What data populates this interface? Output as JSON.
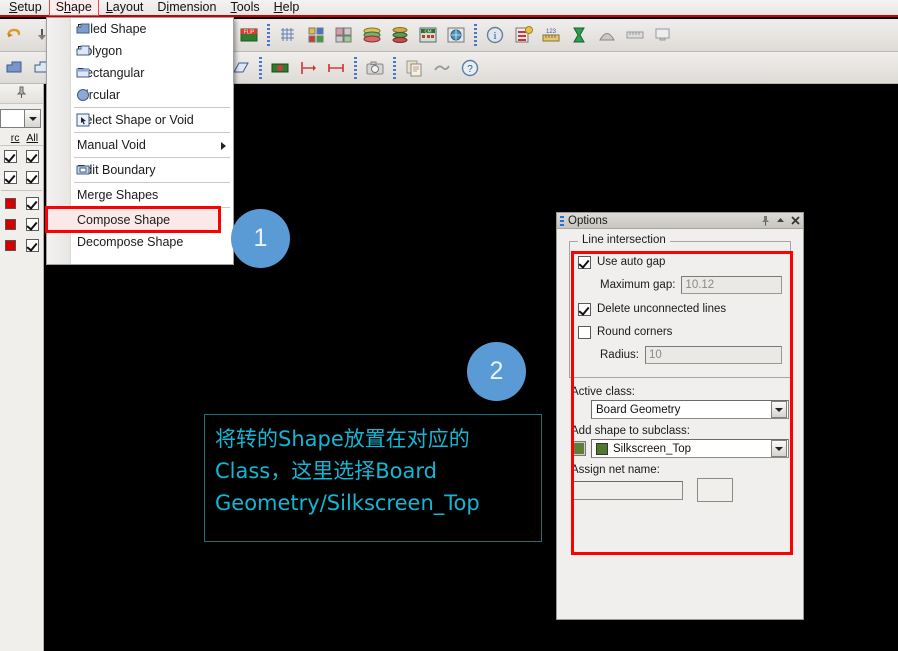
{
  "menubar": {
    "items": [
      {
        "label": "Setup",
        "mnemonic": "S",
        "active": false
      },
      {
        "label": "Shape",
        "mnemonic": "h",
        "active": true
      },
      {
        "label": "Layout",
        "mnemonic": "L",
        "active": false
      },
      {
        "label": "Dimension",
        "mnemonic": "i",
        "active": false
      },
      {
        "label": "Tools",
        "mnemonic": "T",
        "active": false
      },
      {
        "label": "Help",
        "mnemonic": "H",
        "active": false
      }
    ]
  },
  "shape_menu": {
    "highlighted_item": "Compose Shape",
    "items": [
      {
        "label": "Filled Shape",
        "icon": "filled-shape-icon",
        "separator_after": false
      },
      {
        "label": "Polygon",
        "icon": "polygon-icon",
        "separator_after": false
      },
      {
        "label": "Rectangular",
        "icon": "rectangular-icon",
        "separator_after": false
      },
      {
        "label": "Circular",
        "icon": "circular-icon",
        "separator_after": true
      },
      {
        "label": "Select Shape or Void",
        "icon": "select-shape-icon",
        "separator_after": true
      },
      {
        "label": "Manual Void",
        "icon": "",
        "separator_after": true,
        "submenu": true
      },
      {
        "label": "Edit Boundary",
        "icon": "edit-boundary-icon",
        "separator_after": true
      },
      {
        "label": "Merge Shapes",
        "icon": "",
        "separator_after": true
      },
      {
        "label": "Compose Shape",
        "icon": "",
        "separator_after": false,
        "highlighted": true
      },
      {
        "label": "Decompose Shape",
        "icon": "",
        "separator_after": false
      }
    ]
  },
  "left_panel": {
    "header_visibility": "rc",
    "header_all": "All",
    "rows": [
      {
        "swatch": "",
        "checked": true
      },
      {
        "swatch": "",
        "checked": true
      },
      {
        "swatch": "#d40000",
        "checked": true
      },
      {
        "swatch": "#d40000",
        "checked": true
      },
      {
        "swatch": "#d40000",
        "checked": true
      }
    ]
  },
  "options": {
    "title": "Options",
    "pin_icon": "pin-icon",
    "collapse_icon": "collapse-icon",
    "close_icon": "close-icon",
    "line_intersection": {
      "group_label": "Line intersection",
      "use_auto_gap": {
        "label": "Use auto gap",
        "checked": true
      },
      "maximum_gap": {
        "label": "Maximum gap:",
        "value": "10.12"
      },
      "delete_unconnected_lines": {
        "label": "Delete unconnected lines",
        "checked": true
      },
      "round_corners": {
        "label": "Round corners",
        "checked": false
      },
      "radius": {
        "label": "Radius:",
        "value": "10"
      }
    },
    "active_class": {
      "label": "Active class:",
      "value": "Board Geometry"
    },
    "add_shape_subclass": {
      "label": "Add shape to subclass:",
      "value": "Silkscreen_Top",
      "color": "#4f7a2e"
    },
    "assign_net_name": {
      "label": "Assign net name:",
      "value": ""
    }
  },
  "annotations": {
    "marker1": "1",
    "marker2": "2",
    "note_lines": [
      "将转的Shape放置在对应的",
      "Class，这里选择Board",
      "Geometry/Silkscreen_Top"
    ],
    "note_color": "#13b7d4",
    "highlight_color": "#ff0000",
    "marker_color": "#5b9bd5"
  },
  "toolbar_row1": [
    {
      "icon": "undo-icon"
    },
    {
      "icon": "redo-icon"
    },
    {
      "sep": true
    },
    {
      "icon": "zoom-in-icon"
    },
    {
      "icon": "zoom-out-icon"
    },
    {
      "icon": "zoom-fit-icon"
    },
    {
      "icon": "zoom-area-icon"
    },
    {
      "icon": "refresh-icon"
    },
    {
      "icon": "layers-icon"
    },
    {
      "icon": "flip-design-icon"
    },
    {
      "sep": true
    },
    {
      "icon": "grid-toggle-icon"
    },
    {
      "icon": "color-view-icon"
    },
    {
      "icon": "subclass-icon"
    },
    {
      "icon": "stackup-icon"
    },
    {
      "icon": "drc-icon"
    },
    {
      "icon": "cm-icon"
    },
    {
      "icon": "globe-icon"
    },
    {
      "sep": true
    },
    {
      "icon": "info-icon"
    },
    {
      "icon": "report-icon"
    },
    {
      "icon": "measure-icon"
    },
    {
      "icon": "timing-icon"
    },
    {
      "icon": "shape-tool-icon"
    },
    {
      "icon": "ruler-icon"
    },
    {
      "icon": "display-icon"
    }
  ],
  "toolbar_row2": [
    {
      "icon": "filled-shape-tool-icon"
    },
    {
      "icon": "polygon-tool-icon"
    },
    {
      "icon": "rect-tool-icon"
    },
    {
      "icon": "circle-tool-icon"
    },
    {
      "sep": true
    },
    {
      "icon": "select-tool-icon"
    },
    {
      "icon": "void-tool-icon"
    },
    {
      "sep": true
    },
    {
      "icon": "net-icon"
    },
    {
      "icon": "dimension-icon"
    },
    {
      "icon": "measure2-icon"
    },
    {
      "sep": true
    },
    {
      "icon": "snapshot-icon"
    },
    {
      "sep": true
    },
    {
      "icon": "copy-icon"
    },
    {
      "icon": "paste-icon"
    },
    {
      "icon": "help-icon"
    }
  ]
}
